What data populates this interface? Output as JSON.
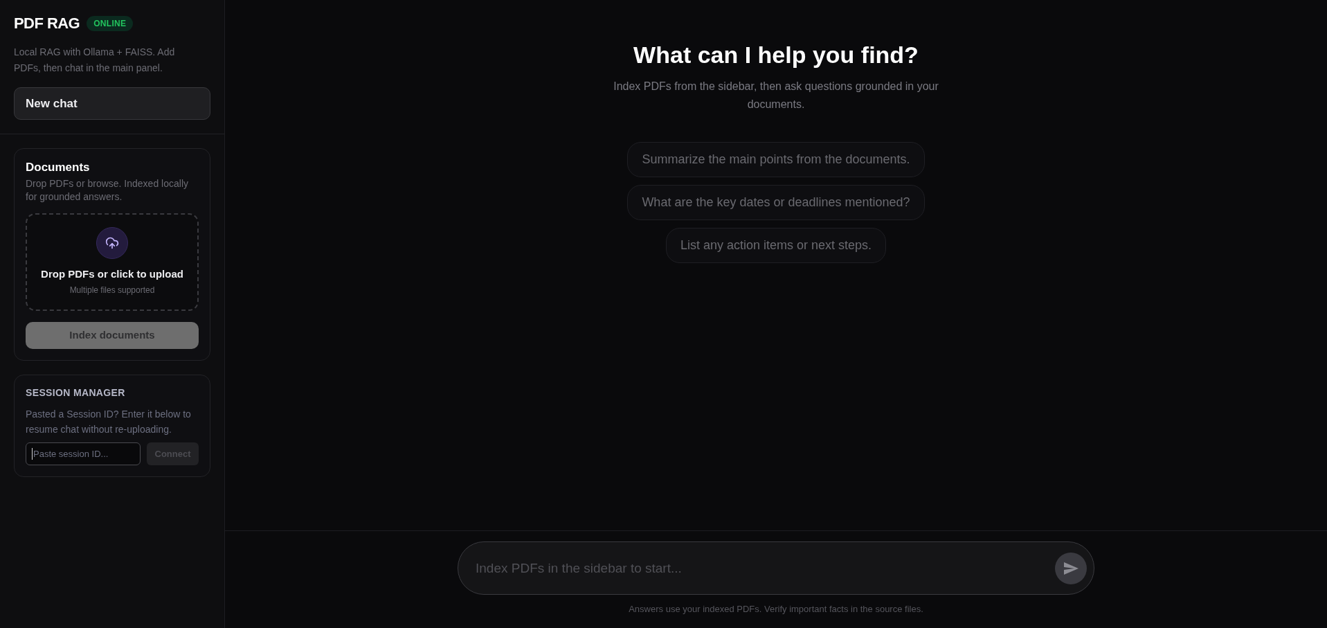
{
  "sidebar": {
    "title": "PDF RAG",
    "status_badge": "ONLINE",
    "description": "Local RAG with Ollama + FAISS. Add PDFs, then chat in the main panel.",
    "new_chat_button": "New chat",
    "documents": {
      "title": "Documents",
      "description": "Drop PDFs or browse. Indexed locally for grounded answers.",
      "dropzone": {
        "label": "Drop PDFs or click to upload",
        "hint": "Multiple files supported"
      },
      "index_button": {
        "label": "Index documents",
        "disabled": true
      }
    },
    "session_manager": {
      "title": "SESSION MANAGER",
      "description": "Pasted a Session ID? Enter it below to resume chat without re-uploading.",
      "input": {
        "placeholder": "Paste session ID...",
        "focused": true
      },
      "connect_button": {
        "label": "Connect",
        "disabled": true
      }
    }
  },
  "main": {
    "heading": "What can I help you find?",
    "subheading": "Index PDFs from the sidebar, then ask questions grounded in your documents.",
    "suggestions": [
      "Summarize the main points from the documents.",
      "What are the key dates or deadlines mentioned?",
      "List any action items or next steps."
    ]
  },
  "composer": {
    "placeholder": "Index PDFs in the sidebar to start...",
    "send_button": {
      "disabled": true
    },
    "footnote": "Answers use your indexed PDFs. Verify important facts in the source files."
  }
}
